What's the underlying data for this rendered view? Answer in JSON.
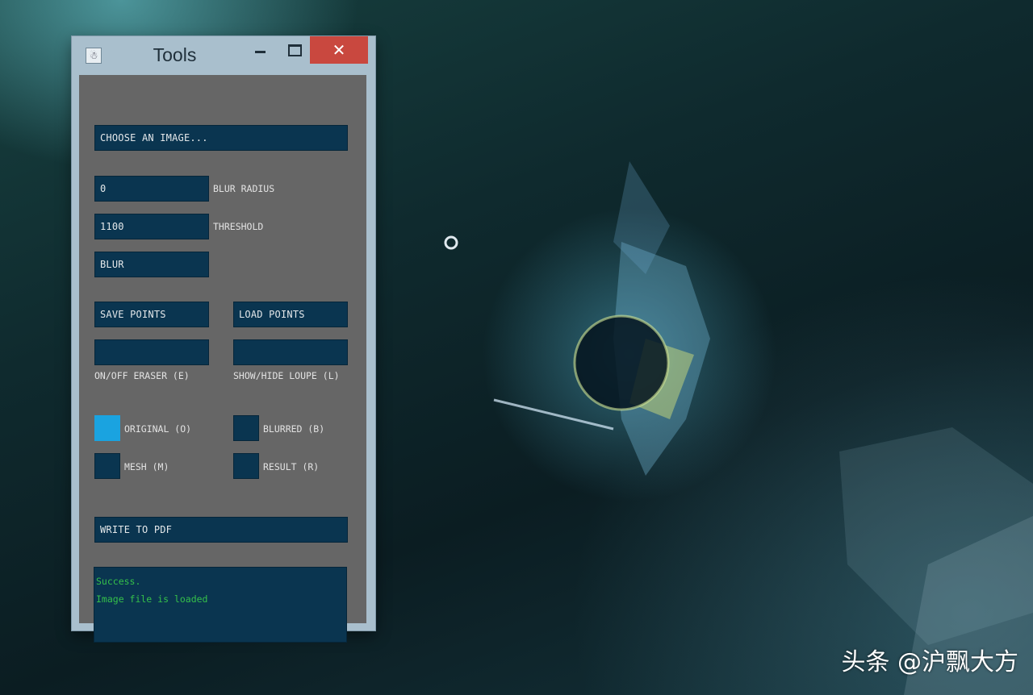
{
  "window": {
    "title": "Tools",
    "icon": "app-icon",
    "close_glyph": "✕"
  },
  "tools": {
    "choose_image": "CHOOSE AN IMAGE...",
    "blur_radius_value": "0",
    "blur_radius_label": "BLUR RADIUS",
    "threshold_value": "1100",
    "threshold_label": "THRESHOLD",
    "blur_button": "BLUR",
    "save_points": "SAVE POINTS",
    "load_points": "LOAD POINTS",
    "eraser_label": "ON/OFF ERASER (E)",
    "loupe_label": "SHOW/HIDE LOUPE (L)",
    "original_label": "ORIGINAL (O)",
    "original_active": true,
    "blurred_label": "BLURRED (B)",
    "blurred_active": false,
    "mesh_label": "MESH (M)",
    "mesh_active": false,
    "result_label": "RESULT (R)",
    "result_active": false,
    "write_pdf": "WRITE TO PDF"
  },
  "log": {
    "lines": [
      "Success.",
      "Image file is loaded"
    ],
    "text_color": "#35c04a"
  },
  "watermark": "头条 @沪飘大方",
  "colors": {
    "control_bg": "#0a3550",
    "panel_bg": "#666666",
    "active_toggle": "#1aa3e0",
    "close_button": "#c9483f"
  }
}
